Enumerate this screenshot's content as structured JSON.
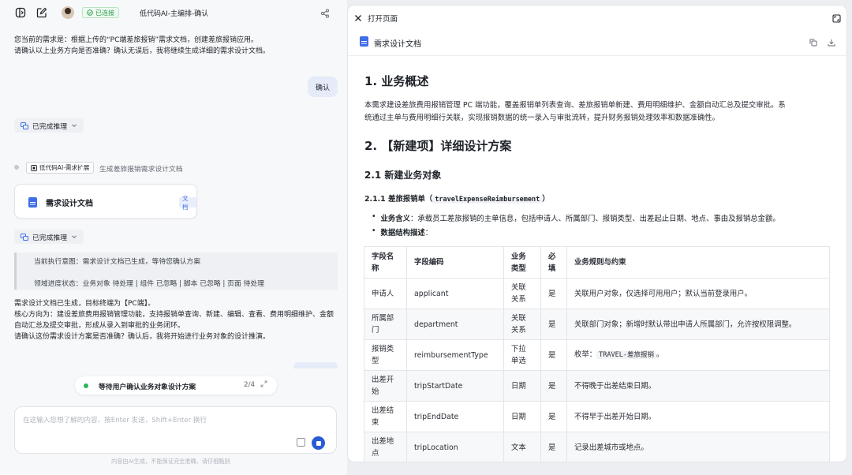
{
  "topbar": {
    "status": "已连接",
    "title": "低代码AI-主编排-确认"
  },
  "chat": {
    "msg1_line1": "您当前的需求是：根据上传的“PC端差旅报销”需求文档，创建差旅报销应用。",
    "msg1_line2": "请确认以上业务方向是否准确？确认无误后，我将继续生成详细的需求设计文档。",
    "user_reply": "确认",
    "reasoning1": "已完成推理",
    "agent_tag": "低代码AI-需求扩展",
    "agent_desc": "生成差旅报销需求设计文档",
    "doc_card_label": "需求设计文档",
    "doc_card_tag": "文档",
    "reasoning2": "已完成推理",
    "quote_line1": "当前执行意图：需求设计文档已生成，等待您确认方案",
    "quote_line2": "领域进度状态：业务对象 待处理 | 组件 已忽略 | 脚本 已忽略 | 页面 待处理",
    "msg2_line1": "需求设计文档已生成，目标终端为【PC端】。",
    "msg2_line2": "核心方向为：建设差旅费用报销管理功能，支持报销单查询、新建、编辑、查看、费用明细维护、金额",
    "msg2_line3": "自动汇总及提交审批，形成从录入到审批的业务闭环。",
    "msg2_line4": "请确认这份需求设计方案是否准确？确认后，我将开始进行业务对象的设计推演。",
    "progress_text": "等待用户确认业务对象设计方案",
    "progress_count": "2/4",
    "input_placeholder": "在这输入您想了解的内容，按Enter 发送，Shift+Enter 换行",
    "footnote": "内容由AI生成，不能保证完全准确，请仔细甄别"
  },
  "panel": {
    "header_title": "打开页面",
    "doc_title": "需求设计文档",
    "h1_overview": "1. 业务概述",
    "overview_line1": "本需求建设差旅费用报销管理 PC 端功能，覆盖报销单列表查询、差旅报销单新建、费用明细维护、金额自动汇总及提交审批。系",
    "overview_line2": "统通过主单与费用明细行关联，实现报销数据的统一录入与审批流转，提升财务报销处理效率和数据准确性。",
    "h1_design": "2. 【新建项】详细设计方案",
    "h3_objects": "2.1 新建业务对象",
    "h4_prefix": "2.1.1 差旅报销单（",
    "h4_code": "travelExpenseReimbursement",
    "h4_suffix": "）",
    "bullet1_label": "业务含义",
    "bullet1_text": "：承载员工差旅报销的主单信息，包括申请人、所属部门、报销类型、出差起止日期、地点、事由及报销总金额。",
    "bullet2_label": "数据结构描述",
    "bullet2_text": "：",
    "table": {
      "headers": [
        "字段名称",
        "字段编码",
        "业务类型",
        "必填",
        "业务规则与约束"
      ],
      "rows": [
        [
          "申请人",
          "applicant",
          "关联关系",
          "是",
          "关联用户对象，仅选择可用用户；默认当前登录用户。"
        ],
        [
          "所属部门",
          "department",
          "关联关系",
          "是",
          "关联部门对象；新增时默认带出申请人所属部门，允许按权限调整。"
        ],
        [
          "报销类型",
          "reimbursementType",
          "下拉单选",
          "是",
          "枚举：",
          "TRAVEL-差旅报销",
          "。"
        ],
        [
          "出差开始",
          "tripStartDate",
          "日期",
          "是",
          "不得晚于出差结束日期。"
        ],
        [
          "出差结束",
          "tripEndDate",
          "日期",
          "是",
          "不得早于出差开始日期。"
        ],
        [
          "出差地点",
          "tripLocation",
          "文本",
          "是",
          "记录出差城市或地点。"
        ]
      ]
    }
  }
}
